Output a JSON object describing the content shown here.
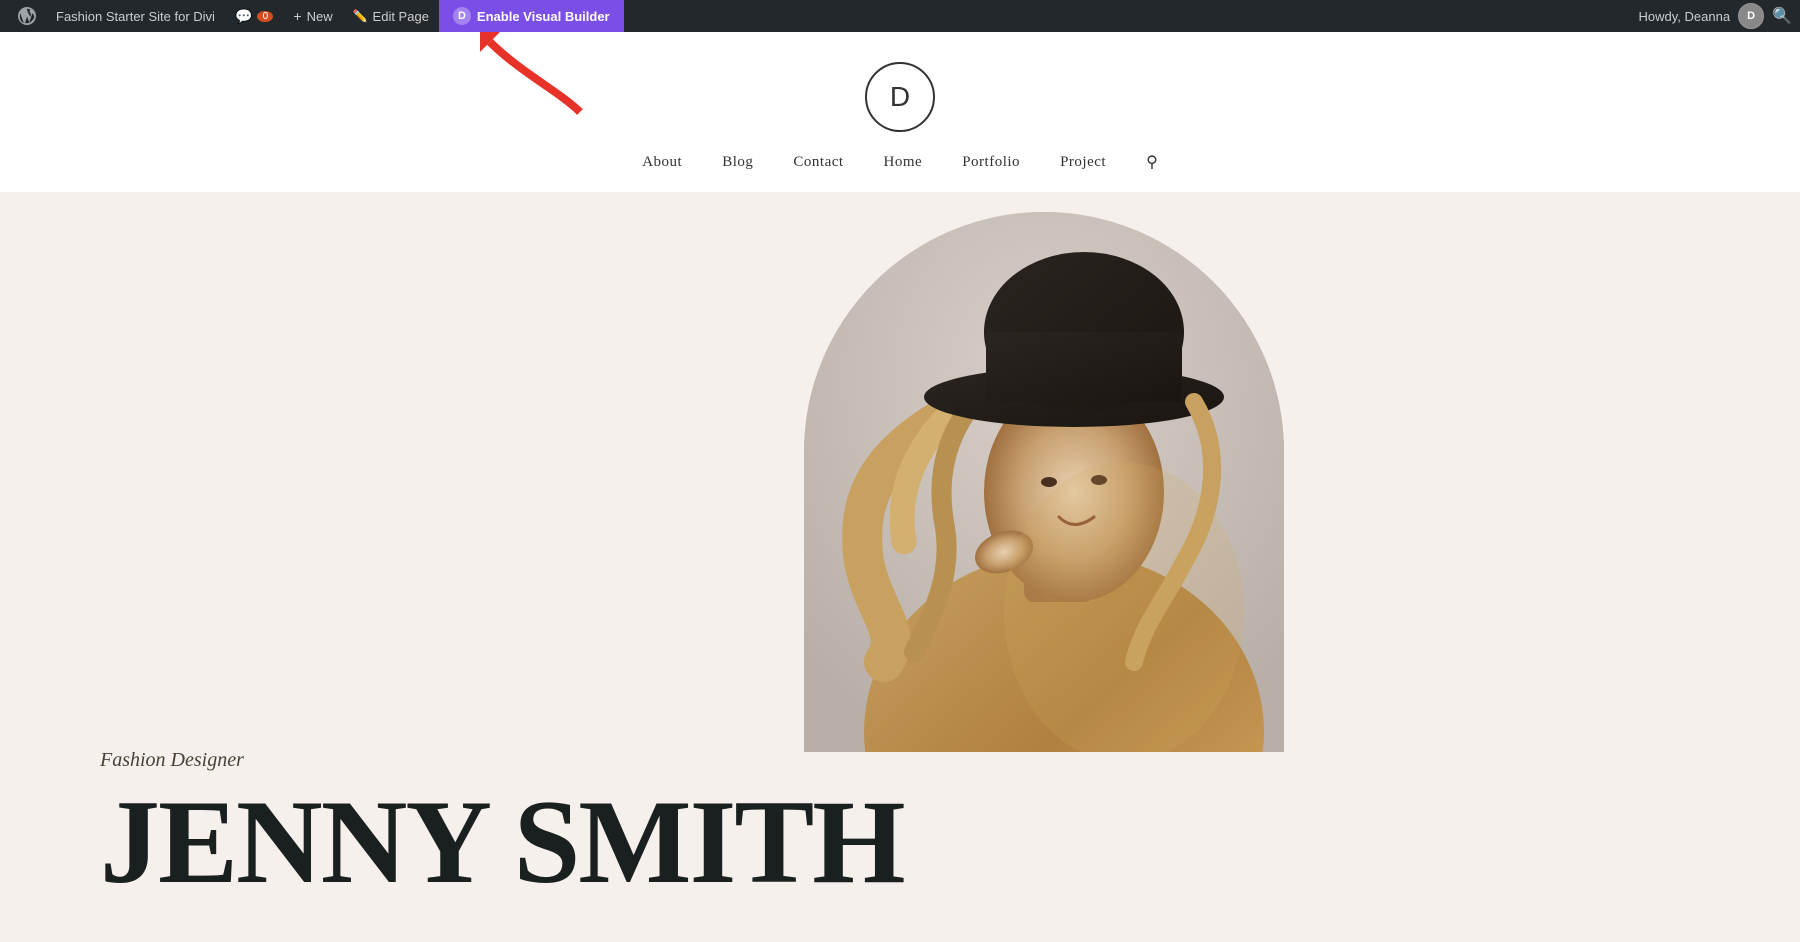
{
  "admin_bar": {
    "site_name": "Fashion Starter Site for Divi",
    "comments_label": "0",
    "new_label": "New",
    "edit_page_label": "Edit Page",
    "divi_logo": "D",
    "enable_builder_label": "Enable Visual Builder",
    "howdy_text": "Howdy, Deanna",
    "search_icon": "search-icon"
  },
  "site": {
    "logo_letter": "D",
    "nav": {
      "items": [
        {
          "label": "About"
        },
        {
          "label": "Blog"
        },
        {
          "label": "Contact"
        },
        {
          "label": "Home"
        },
        {
          "label": "Portfolio"
        },
        {
          "label": "Project"
        }
      ]
    }
  },
  "hero": {
    "subtitle": "Fashion Designer",
    "name_line1": "JENNY SMITH",
    "name_display": "JENNY SMITH"
  },
  "colors": {
    "admin_bar_bg": "#23282d",
    "divi_purple": "#7B4EE8",
    "hero_bg": "#f5f0eb",
    "nav_text": "#333333",
    "hero_name_color": "#1a2020"
  }
}
